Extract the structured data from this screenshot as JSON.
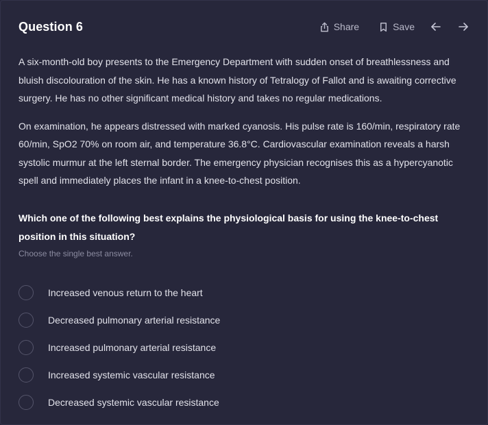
{
  "header": {
    "title": "Question 6",
    "share_label": "Share",
    "save_label": "Save",
    "icons": [
      "share-icon",
      "bookmark-icon",
      "arrow-left-icon",
      "arrow-right-icon"
    ]
  },
  "stem": {
    "paragraphs": [
      "A six-month-old boy presents to the Emergency Department with sudden onset of breathlessness and bluish discolouration of the skin. He has a known history of Tetralogy of Fallot and is awaiting corrective surgery. He has no other significant medical history and takes no regular medications.",
      "On examination, he appears distressed with marked cyanosis. His pulse rate is 160/min, respiratory rate 60/min, SpO2 70% on room air, and temperature 36.8°C. Cardiovascular examination reveals a harsh systolic murmur at the left sternal border. The emergency physician recognises this as a hypercyanotic spell and immediately places the infant in a knee-to-chest position."
    ]
  },
  "question": {
    "text": "Which one of the following best explains the physiological basis for using the knee-to-chest position in this situation?",
    "instruction": "Choose the single best answer."
  },
  "options": [
    {
      "label": "Increased venous return to the heart"
    },
    {
      "label": "Decreased pulmonary arterial resistance"
    },
    {
      "label": "Increased pulmonary arterial resistance"
    },
    {
      "label": "Increased systemic vascular resistance"
    },
    {
      "label": "Decreased systemic vascular resistance"
    }
  ],
  "colors": {
    "background": "#27273b",
    "text": "#e2e2ea",
    "muted": "#8b8ba0",
    "radio_border": "#55556b"
  }
}
